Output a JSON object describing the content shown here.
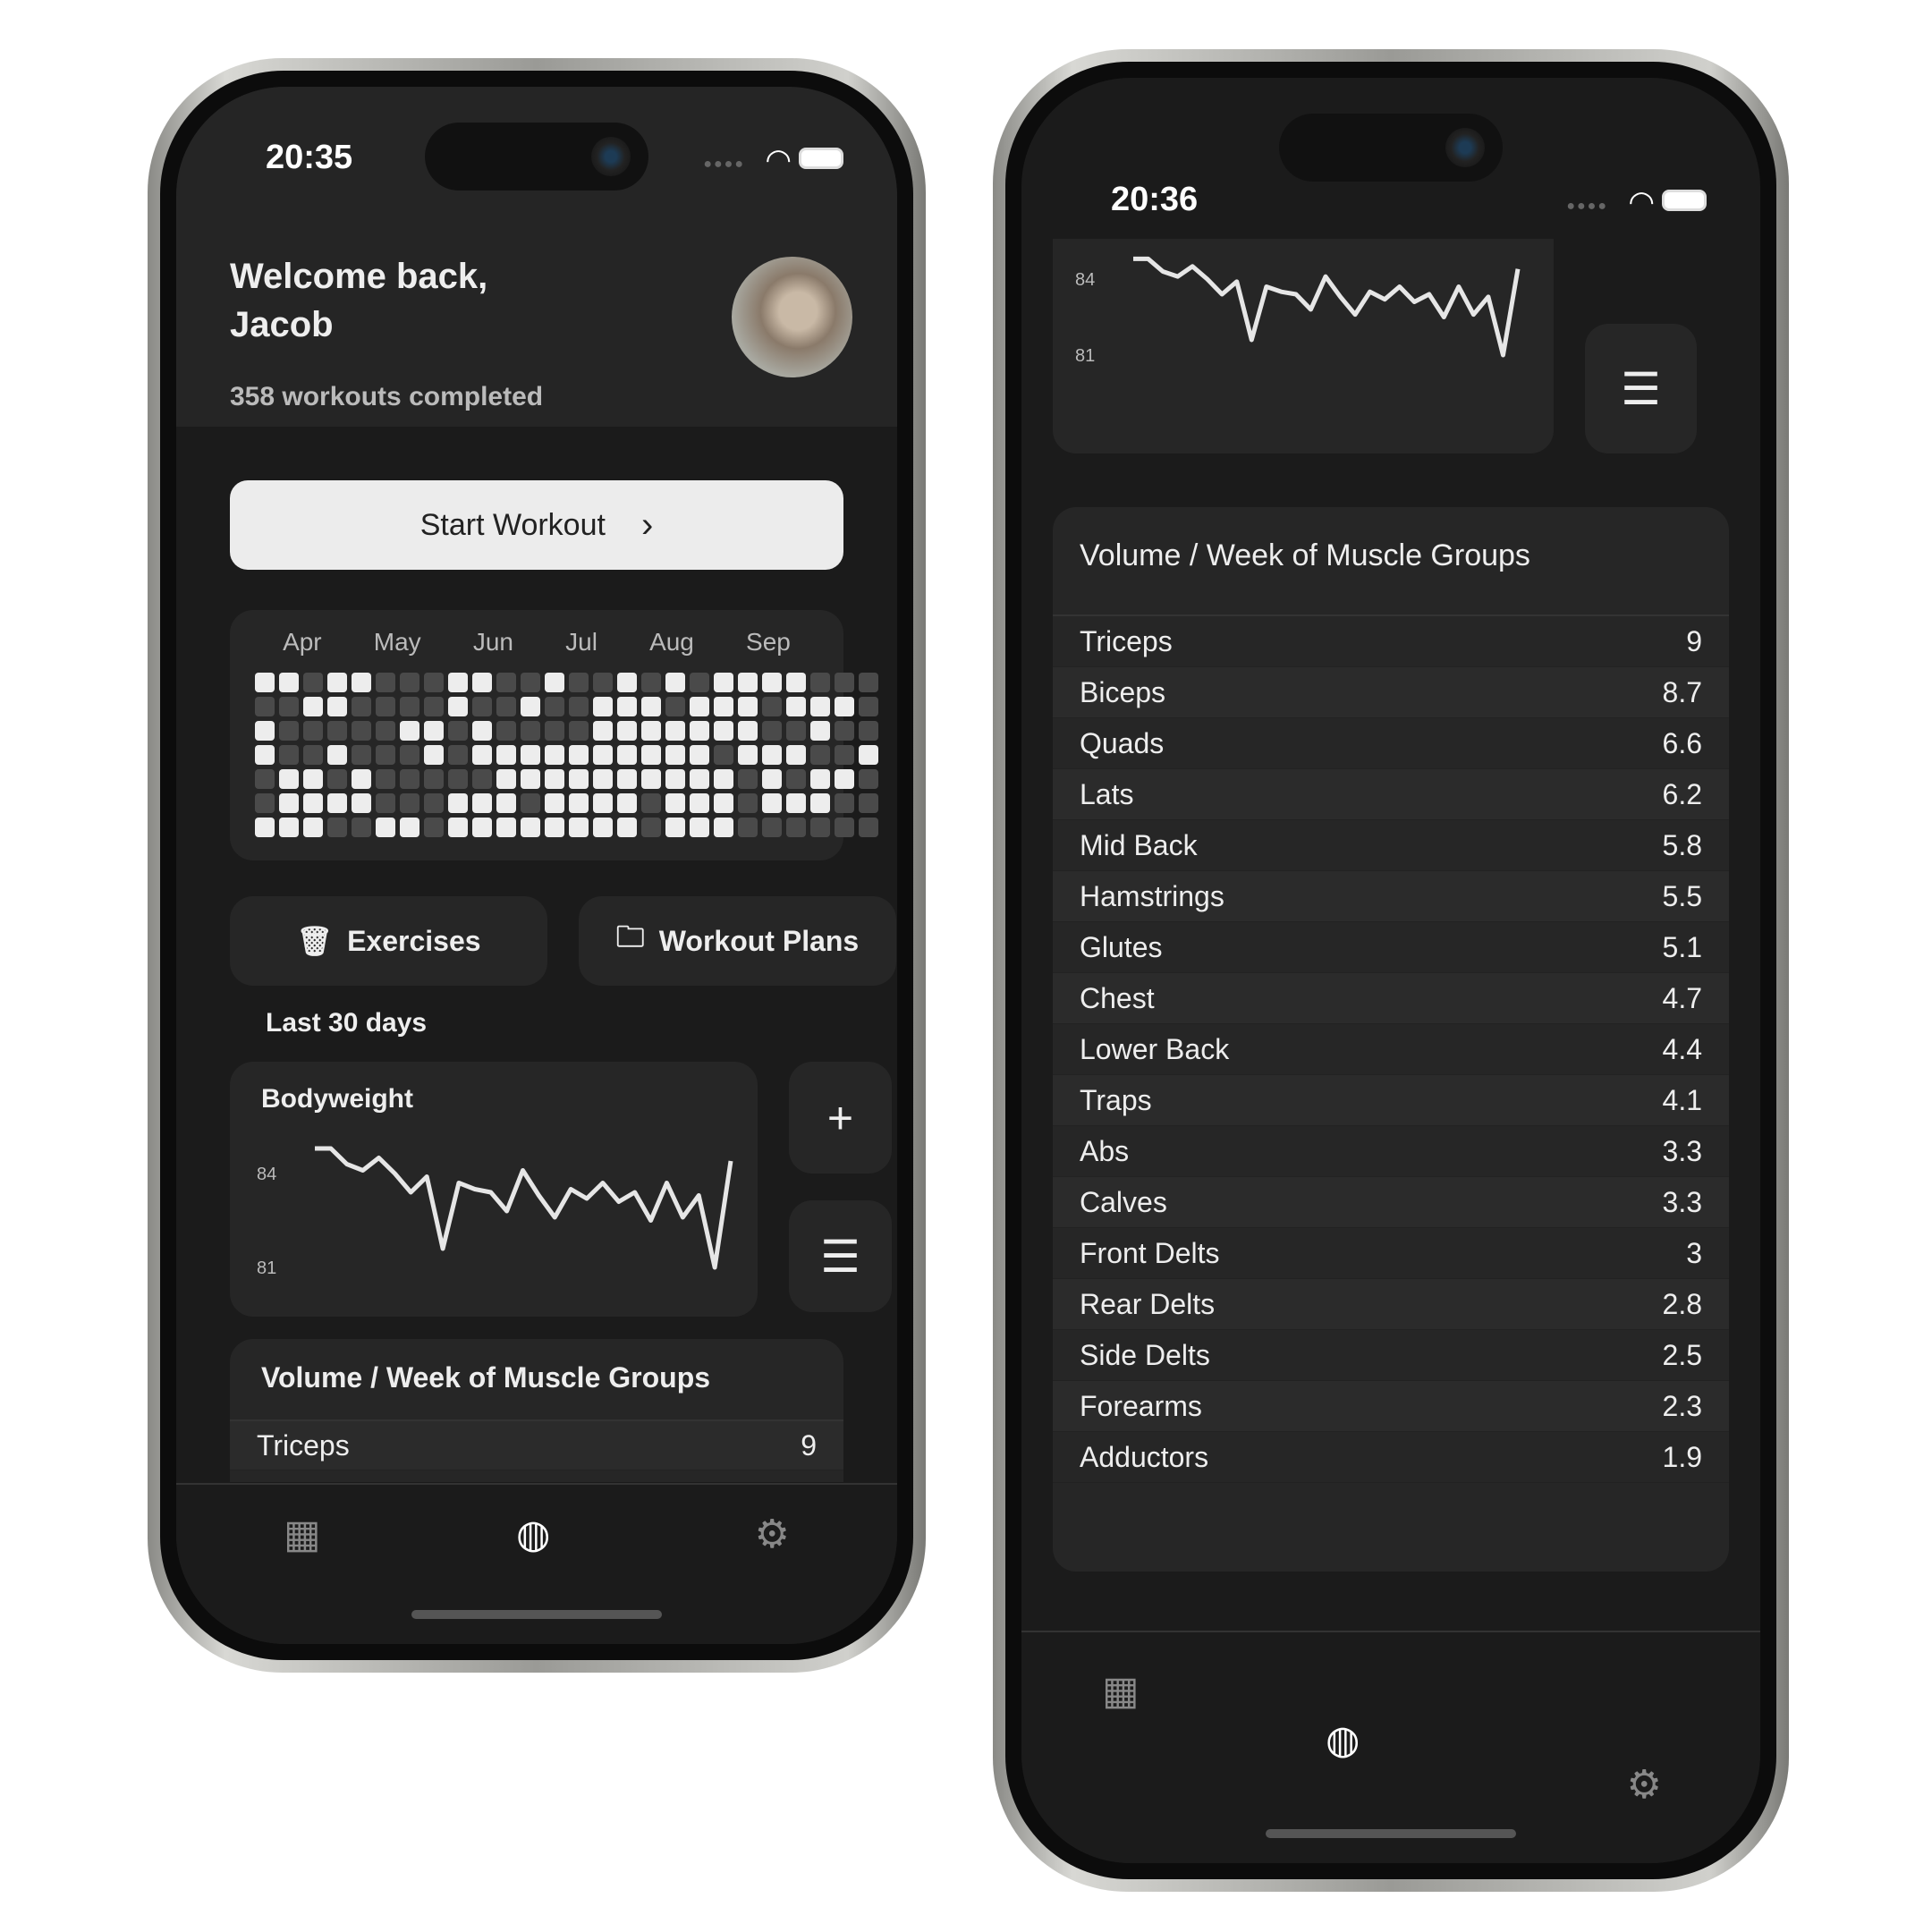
{
  "left": {
    "status": {
      "time": "20:35"
    },
    "header": {
      "greeting": "Welcome back,",
      "name": "Jacob",
      "subtitle": "358 workouts completed"
    },
    "start_workout": {
      "label": "Start Workout",
      "icon": "chevron-right-icon"
    },
    "activity": {
      "months": [
        "Apr",
        "May",
        "Jun",
        "Jul",
        "Aug",
        "Sep"
      ],
      "grid": [
        [
          1,
          1,
          0,
          1,
          1,
          0,
          0,
          0,
          1,
          1,
          0,
          0,
          1,
          0,
          0,
          1,
          0,
          1,
          0,
          1,
          1,
          1,
          1,
          0,
          0,
          0
        ],
        [
          0,
          0,
          1,
          1,
          0,
          0,
          0,
          0,
          1,
          0,
          0,
          1,
          0,
          0,
          1,
          1,
          1,
          0,
          1,
          1,
          1,
          0,
          1,
          1,
          1,
          0
        ],
        [
          1,
          0,
          0,
          0,
          0,
          0,
          1,
          1,
          0,
          1,
          0,
          0,
          0,
          0,
          1,
          1,
          1,
          1,
          1,
          1,
          1,
          0,
          0,
          1,
          0,
          0
        ],
        [
          1,
          0,
          0,
          1,
          0,
          0,
          0,
          1,
          0,
          1,
          1,
          1,
          1,
          1,
          1,
          1,
          1,
          1,
          1,
          0,
          1,
          1,
          1,
          0,
          0,
          1
        ],
        [
          0,
          1,
          1,
          0,
          1,
          0,
          0,
          0,
          0,
          0,
          1,
          1,
          1,
          1,
          1,
          1,
          1,
          1,
          1,
          1,
          0,
          1,
          0,
          1,
          1,
          0
        ],
        [
          0,
          1,
          1,
          1,
          1,
          0,
          0,
          0,
          1,
          1,
          1,
          0,
          1,
          1,
          1,
          1,
          0,
          1,
          1,
          1,
          0,
          1,
          1,
          1,
          0,
          0
        ],
        [
          1,
          1,
          1,
          0,
          0,
          1,
          1,
          0,
          1,
          1,
          1,
          1,
          1,
          1,
          1,
          1,
          0,
          1,
          1,
          1,
          0,
          0,
          0,
          0,
          0,
          0
        ]
      ]
    },
    "exercises_label": "Exercises",
    "plans_label": "Workout Plans",
    "period_label": "Last 30 days",
    "bodyweight_title": "Bodyweight",
    "volume_title": "Volume / Week of Muscle Groups",
    "first_row": {
      "name": "Triceps",
      "value": "9"
    }
  },
  "right": {
    "status": {
      "time": "20:36"
    }
  },
  "chart_data": {
    "type": "line",
    "title": "Bodyweight",
    "yticks": [
      "84",
      "81"
    ],
    "ylim": [
      80.8,
      85
    ],
    "values": [
      84.8,
      84.8,
      84.3,
      84.1,
      84.5,
      84.0,
      83.4,
      83.9,
      81.6,
      83.7,
      83.5,
      83.4,
      82.8,
      84.1,
      83.3,
      82.6,
      83.5,
      83.2,
      83.7,
      83.1,
      83.4,
      82.5,
      83.7,
      82.6,
      83.3,
      81.0,
      84.4
    ]
  },
  "volume": [
    {
      "name": "Triceps",
      "value": "9"
    },
    {
      "name": "Biceps",
      "value": "8.7"
    },
    {
      "name": "Quads",
      "value": "6.6"
    },
    {
      "name": "Lats",
      "value": "6.2"
    },
    {
      "name": "Mid Back",
      "value": "5.8"
    },
    {
      "name": "Hamstrings",
      "value": "5.5"
    },
    {
      "name": "Glutes",
      "value": "5.1"
    },
    {
      "name": "Chest",
      "value": "4.7"
    },
    {
      "name": "Lower Back",
      "value": "4.4"
    },
    {
      "name": "Traps",
      "value": "4.1"
    },
    {
      "name": "Abs",
      "value": "3.3"
    },
    {
      "name": "Calves",
      "value": "3.3"
    },
    {
      "name": "Front Delts",
      "value": "3"
    },
    {
      "name": "Rear Delts",
      "value": "2.8"
    },
    {
      "name": "Side Delts",
      "value": "2.5"
    },
    {
      "name": "Forearms",
      "value": "2.3"
    },
    {
      "name": "Adductors",
      "value": "1.9"
    }
  ],
  "tabs": [
    {
      "icon": "calendar-icon"
    },
    {
      "icon": "dashboard-icon"
    },
    {
      "icon": "settings-icon"
    }
  ],
  "colors": {
    "background": "#1b1b1b",
    "card": "#262626",
    "accent": "#ededed"
  }
}
